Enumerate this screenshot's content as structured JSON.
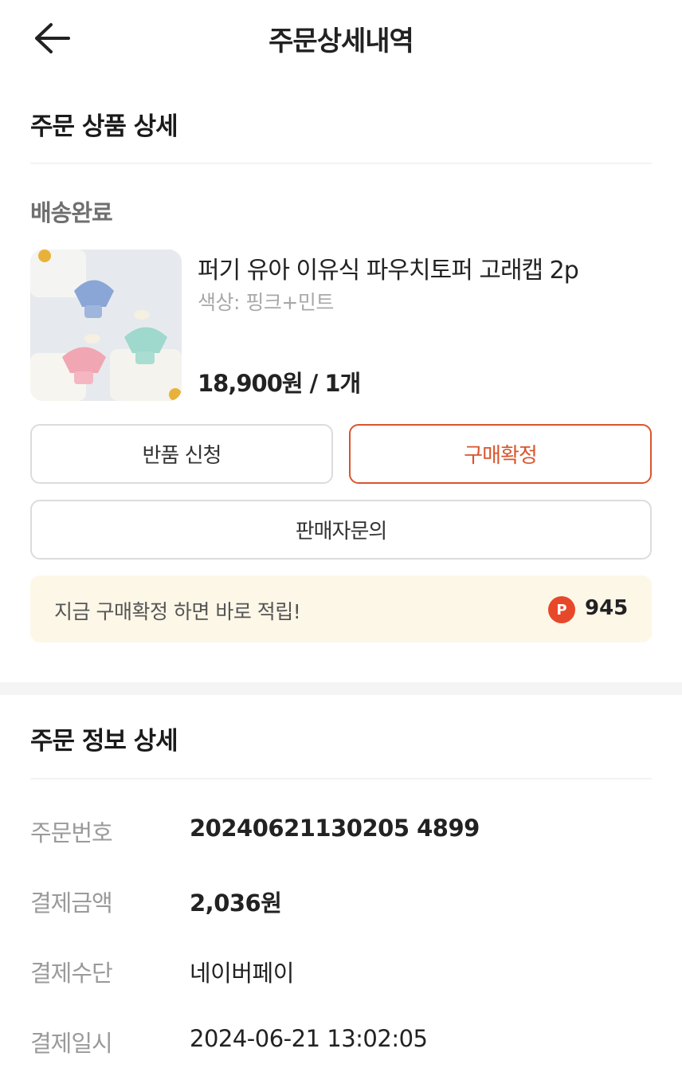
{
  "header": {
    "title": "주문상세내역",
    "back_icon": "arrow-left-icon"
  },
  "order_items": {
    "section_title": "주문 상품 상세",
    "status": "배송완료",
    "product": {
      "name": "퍼기 유아 이유식 파우치토퍼 고래캡 2p",
      "option": "색상: 핑크+민트",
      "price": "18,900원 / 1개",
      "image": "product-thumbnail"
    },
    "buttons": {
      "return": "반품 신청",
      "confirm": "구매확정",
      "inquiry": "판매자문의"
    },
    "notice": {
      "text": "지금 구매확정 하면 바로 적립!",
      "point_badge": "P",
      "points": "945"
    }
  },
  "order_info": {
    "section_title": "주문 정보 상세",
    "rows": [
      {
        "label": "주문번호",
        "value": "20240621130205 4899"
      },
      {
        "label": "결제금액",
        "value": "2,036원"
      },
      {
        "label": "결제수단",
        "value": "네이버페이"
      },
      {
        "label": "결제일시",
        "value": "2024-06-21 13:02:05"
      }
    ]
  },
  "colors": {
    "accent": "#d9552d",
    "notice_bg": "#fdf7e8",
    "point_badge": "#e8482a"
  }
}
